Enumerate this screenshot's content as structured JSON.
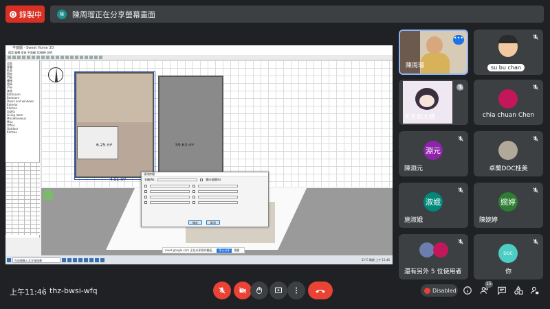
{
  "top": {
    "recording_label": "錄製中",
    "banner_text": "陳周瑠正在分享螢幕畫面",
    "banner_avatar_initial": "陳"
  },
  "shared_screen": {
    "app_title": "平面圖 - Sweet Home 3D",
    "menu": "檔案 編輯 家具 平面圖 3D檢視 說明",
    "tree_items": [
      "浴室",
      "客廳",
      "臥室",
      "廚房",
      "門窗",
      "樓梯",
      "燈具",
      "戶外",
      "其他",
      "Bathroom",
      "Bedroom",
      "Doors and windows",
      "Exterior",
      "Kitchen",
      "Lights",
      "Living room",
      "Miscellaneous",
      "Misc",
      "Office",
      "Outdoor",
      "Kitchen"
    ],
    "plan_label_1": "59.63 m²",
    "plan_label_2": "6.25 m²",
    "plan_label_3": "4.51 m²",
    "dialog_title": "修改房間",
    "dialog_name_label": "名稱(N):",
    "dialog_area_label": "顯示面積(A)",
    "dialog_ok": "確定",
    "dialog_cancel": "取消",
    "notif_text": "meet.google.com 正在分享您的畫面。",
    "notif_stop": "停止分享",
    "notif_hide": "隱藏",
    "search_text": "在這裡輸入文字來搜尋",
    "tray_text": "31°C 晴朗 上午 11:46"
  },
  "participants": [
    {
      "name": "陳周瑠",
      "type": "video",
      "active": true
    },
    {
      "name": "su bu chan",
      "type": "video"
    },
    {
      "name": "毛毛和大嬿",
      "type": "video"
    },
    {
      "name": "chia chuan Chen",
      "type": "avatar-photo",
      "color": "#c2185b"
    },
    {
      "name": "陳淵元",
      "type": "initials",
      "initials": "淵元",
      "color": "#8e24aa"
    },
    {
      "name": "卓蘭DOC桂美",
      "type": "avatar-photo",
      "color": "#b0a999"
    },
    {
      "name": "施淑娥",
      "type": "initials",
      "initials": "淑娥",
      "color": "#00897b"
    },
    {
      "name": "陳婉婷",
      "type": "initials",
      "initials": "婉婷",
      "color": "#2e7d32"
    },
    {
      "name": "還有另外 5 位使用者",
      "type": "group"
    },
    {
      "name": "你",
      "type": "avatar-photo",
      "color": "#4ecdc4",
      "avatar_text": "DOC"
    }
  ],
  "bottom": {
    "time": "上午11:46",
    "meeting_code": "thz-bwsi-wfq",
    "disabled_label": "Disabled",
    "people_count": "15"
  },
  "colors": {
    "background": "#202124",
    "tile": "#3c4043",
    "red": "#ea4335",
    "blue": "#1a73e8"
  }
}
